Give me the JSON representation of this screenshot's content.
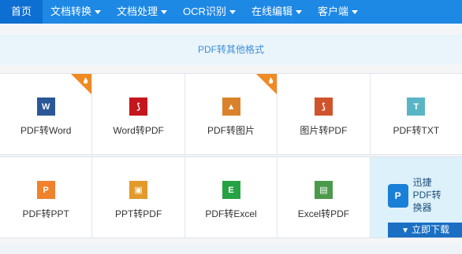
{
  "nav": {
    "items": [
      {
        "label": "首页",
        "active": true,
        "dropdown": false
      },
      {
        "label": "文档转换",
        "active": false,
        "dropdown": true
      },
      {
        "label": "文档处理",
        "active": false,
        "dropdown": true
      },
      {
        "label": "OCR识别",
        "active": false,
        "dropdown": true
      },
      {
        "label": "在线编辑",
        "active": false,
        "dropdown": true
      },
      {
        "label": "客户端",
        "active": false,
        "dropdown": true
      }
    ]
  },
  "section": {
    "title": "PDF转其他格式"
  },
  "row1": [
    {
      "label": "PDF转Word",
      "icon": "word-icon",
      "glyph": "W",
      "color": "#2b5797",
      "hot": true
    },
    {
      "label": "Word转PDF",
      "icon": "pdf-icon",
      "glyph": "⟆",
      "color": "#c4161c",
      "hot": false
    },
    {
      "label": "PDF转图片",
      "icon": "image-icon",
      "glyph": "▲",
      "color": "#d9822b",
      "hot": true
    },
    {
      "label": "图片转PDF",
      "icon": "pdf-icon",
      "glyph": "⟆",
      "color": "#d0542b",
      "hot": false
    },
    {
      "label": "PDF转TXT",
      "icon": "txt-icon",
      "glyph": "T",
      "color": "#59b5c6",
      "hot": false
    }
  ],
  "row2": [
    {
      "label": "PDF转PPT",
      "icon": "ppt-icon",
      "glyph": "P",
      "color": "#f0822d"
    },
    {
      "label": "PPT转PDF",
      "icon": "ppt-pdf-icon",
      "glyph": "▣",
      "color": "#e29a2a"
    },
    {
      "label": "PDF转Excel",
      "icon": "excel-icon",
      "glyph": "E",
      "color": "#25a244"
    },
    {
      "label": "Excel转PDF",
      "icon": "excel-pdf-icon",
      "glyph": "▤",
      "color": "#4b9a4b"
    }
  ],
  "promo": {
    "line1": "迅捷",
    "line2": "PDF转",
    "line3": "换器",
    "button": "立即下载",
    "logo_glyph": "P"
  },
  "colors": {
    "nav": "#1e88e5",
    "hot": "#f08a24"
  }
}
